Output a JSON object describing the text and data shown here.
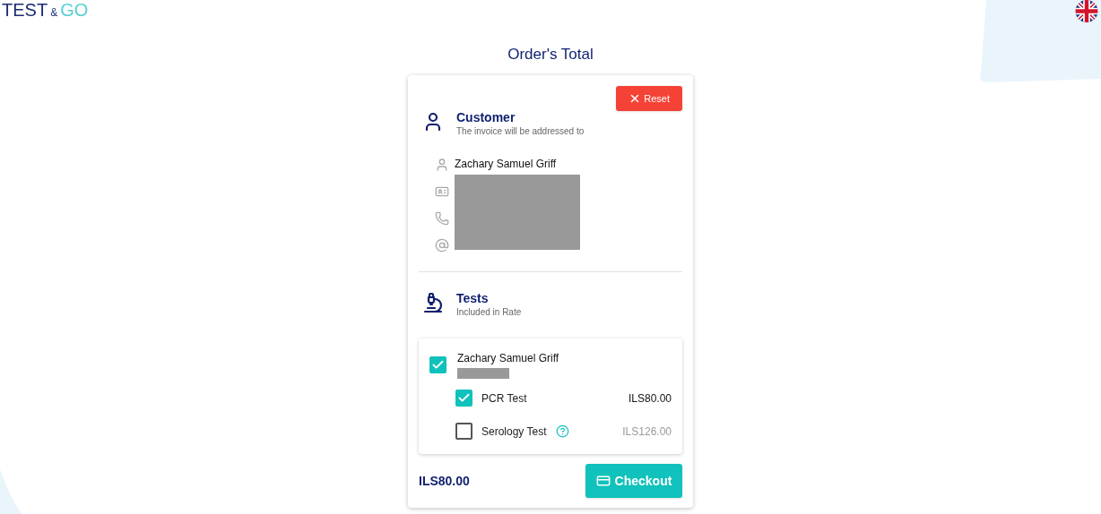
{
  "logo": {
    "word_1": "TEST",
    "ampersand": "&",
    "word_2": "GO"
  },
  "title": "Order's Total",
  "reset_button": "Reset",
  "customer": {
    "heading": "Customer",
    "subtitle": "The invoice will be addressed to",
    "name": "Zachary Samuel Griff"
  },
  "tests": {
    "heading": "Tests",
    "subtitle": "Included in Rate",
    "person": {
      "name": "Zachary Samuel Griff",
      "checked": true
    },
    "items": [
      {
        "label": "PCR Test",
        "price": "ILS80.00",
        "checked": true,
        "help": false
      },
      {
        "label": "Serology Test",
        "price": "ILS126.00",
        "checked": false,
        "help": true
      }
    ]
  },
  "total": "ILS80.00",
  "checkout_button": "Checkout"
}
